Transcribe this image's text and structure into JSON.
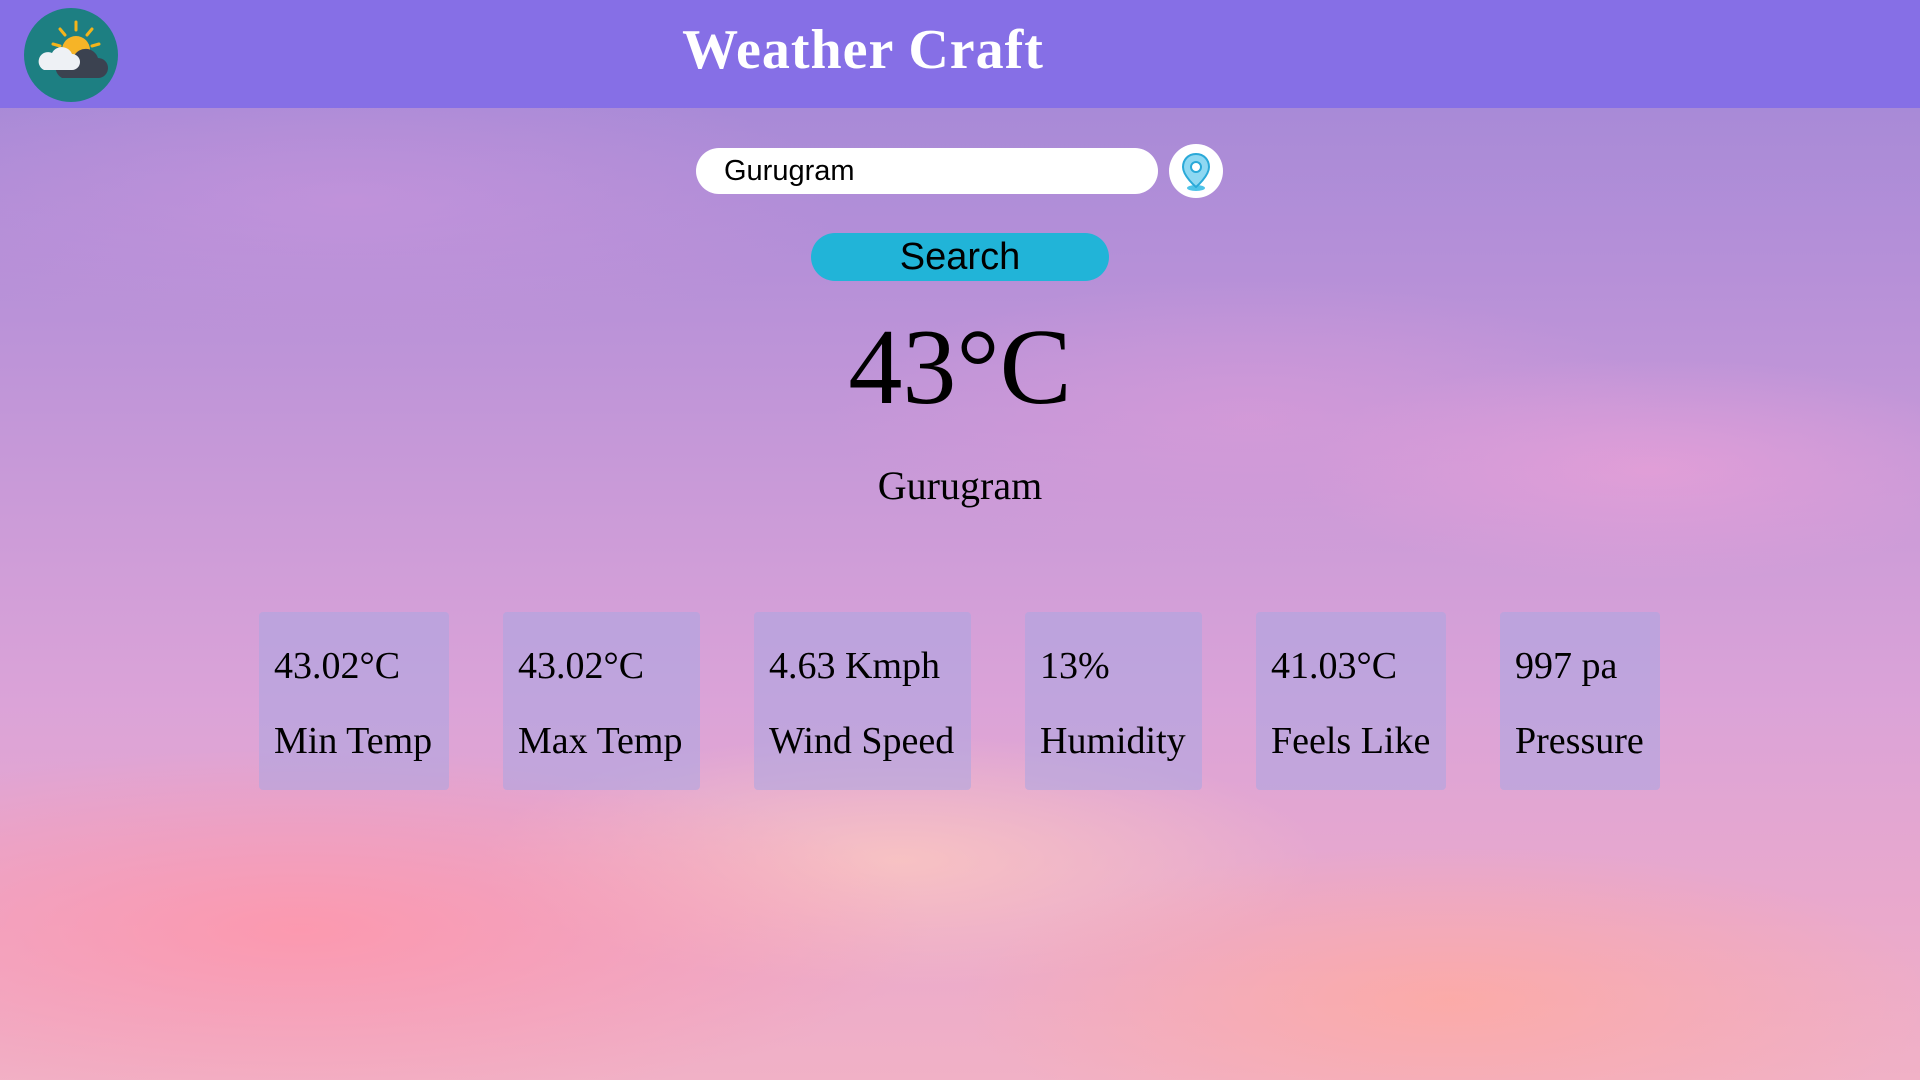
{
  "header": {
    "title": "Weather Craft",
    "logo_icon": "sun-cloud-icon",
    "background_color": "#866fe6"
  },
  "search": {
    "value": "Gurugram",
    "location_icon": "map-pin-icon",
    "button_label": "Search",
    "button_color": "#21b4d8"
  },
  "current": {
    "temperature": "43°C",
    "city": "Gurugram"
  },
  "stats": [
    {
      "value": "43.02°C",
      "label": "Min Temp"
    },
    {
      "value": "43.02°C",
      "label": "Max Temp"
    },
    {
      "value": "4.63 Kmph",
      "label": "Wind Speed"
    },
    {
      "value": "13%",
      "label": "Humidity"
    },
    {
      "value": "41.03°C",
      "label": "Feels Like"
    },
    {
      "value": "997 pa",
      "label": "Pressure"
    }
  ]
}
